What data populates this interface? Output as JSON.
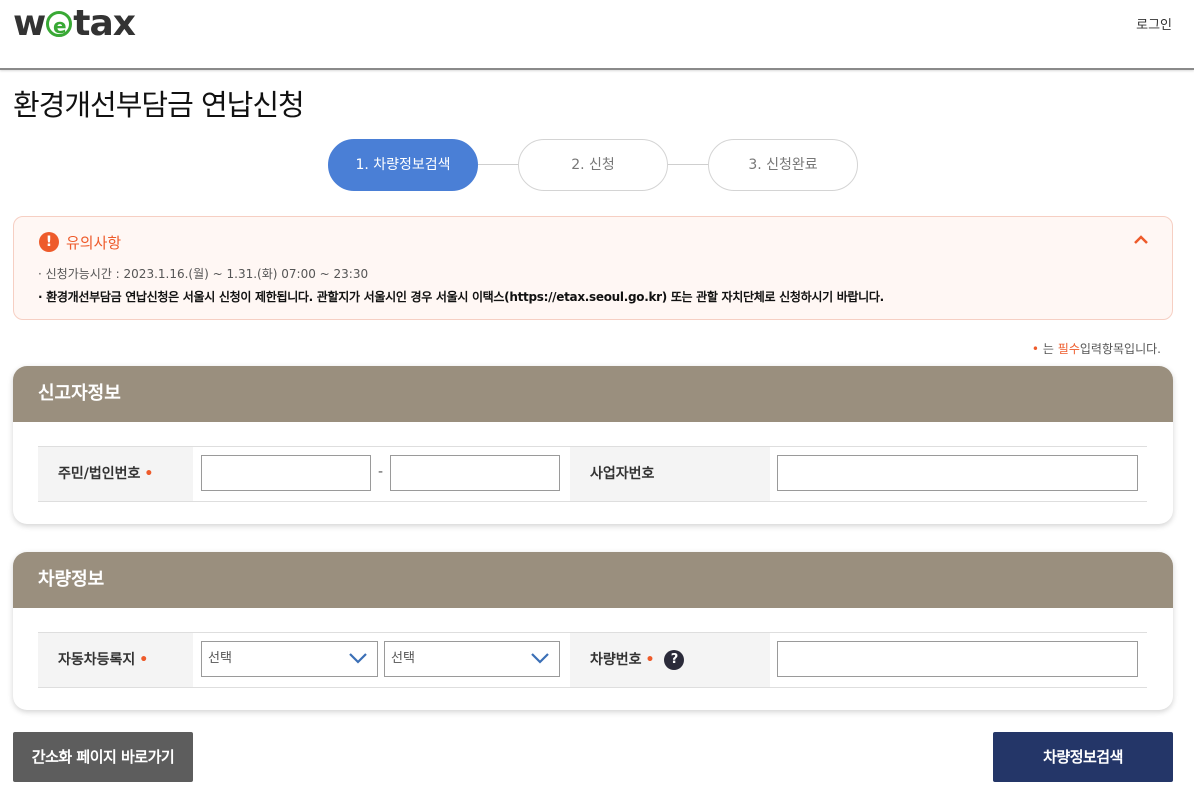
{
  "header": {
    "logo_left": "w",
    "logo_e": "e",
    "logo_right": "tax",
    "login_label": "로그인"
  },
  "page_title": "환경개선부담금 연납신청",
  "steps": [
    {
      "label": "1. 차량정보검색",
      "active": true
    },
    {
      "label": "2. 신청",
      "active": false
    },
    {
      "label": "3. 신청완료",
      "active": false
    }
  ],
  "notice": {
    "icon": "!",
    "title": "유의사항",
    "line1": "· 신청가능시간 : 2023.1.16.(월) ~ 1.31.(화) 07:00 ~ 23:30",
    "line2": "· 환경개선부담금 연납신청은 서울시 신청이 제한됩니다. 관할지가 서울시인 경우 서울시 이택스(https://etax.seoul.go.kr) 또는 관할 자치단체로 신청하시기 바랍니다."
  },
  "required_note": {
    "dot": "•",
    "pre": "는",
    "emphasis": "필수",
    "post": "입력항목입니다."
  },
  "reporter": {
    "title": "신고자정보",
    "id_label": "주민/법인번호",
    "required_mark": "•",
    "dash": "-",
    "biz_label": "사업자번호"
  },
  "vehicle": {
    "title": "차량정보",
    "region_label": "자동차등록지",
    "required_mark": "•",
    "select1": "선택",
    "select2": "선택",
    "plate_label": "차량번호",
    "help": "?"
  },
  "buttons": {
    "simple_label": "간소화 페이지 바로가기",
    "search_label": "차량정보검색"
  },
  "colors": {
    "active_step": "#4a7fd6",
    "panel_header": "#9a8f7e",
    "accent": "#ee5b2b",
    "search_button": "#243668",
    "simple_button": "#5d5d5d"
  }
}
